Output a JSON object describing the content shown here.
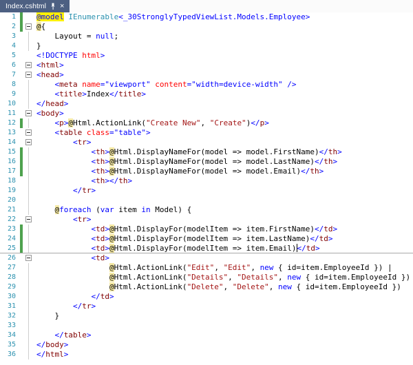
{
  "window": {
    "tab": {
      "title": "Index.cshtml",
      "pin_icon": "pin-icon",
      "close_glyph": "×"
    }
  },
  "palette": {
    "tabBg": "#4D6082",
    "tabFg": "#FFFFFF",
    "editorBg": "#FFFFFF",
    "lineNumber": "#2B91AF",
    "changeBar": "#4EA24E",
    "razorBg": "#F5E9A4",
    "highlightBg": "#FDF005",
    "caretLineBorder": "#A8A8A8",
    "colors": {
      "kw": "#0000FF",
      "type": "#2B91AF",
      "tag": "#800000",
      "attr": "#FF0000",
      "str": "#A31515",
      "txt": "#000000"
    }
  },
  "editor": {
    "lines": [
      {
        "n": 1,
        "fold": "",
        "chg": true,
        "seg": [
          {
            "t": "@model",
            "c": "kw",
            "b": "hl"
          },
          {
            "t": " "
          },
          {
            "t": "IEnumerable",
            "c": "type"
          },
          {
            "t": "<_30StronglyTypedViewList.Models.Employee>",
            "c": "kw"
          }
        ]
      },
      {
        "n": 2,
        "fold": "box",
        "chg": true,
        "seg": [
          {
            "t": "@",
            "b": "razor"
          },
          {
            "t": "{"
          }
        ]
      },
      {
        "n": 3,
        "fold": "line",
        "seg": [
          {
            "t": "    Layout = "
          },
          {
            "t": "null",
            "c": "kw"
          },
          {
            "t": ";"
          }
        ]
      },
      {
        "n": 4,
        "fold": "line",
        "seg": [
          {
            "t": "}"
          }
        ]
      },
      {
        "n": 5,
        "fold": "",
        "seg": [
          {
            "t": "<!DOCTYPE ",
            "c": "kw"
          },
          {
            "t": "html",
            "c": "attr"
          },
          {
            "t": ">",
            "c": "kw"
          }
        ]
      },
      {
        "n": 6,
        "fold": "box",
        "seg": [
          {
            "t": "<",
            "c": "kw"
          },
          {
            "t": "html",
            "c": "tag"
          },
          {
            "t": ">",
            "c": "kw"
          }
        ]
      },
      {
        "n": 7,
        "fold": "box",
        "seg": [
          {
            "t": "<",
            "c": "kw"
          },
          {
            "t": "head",
            "c": "tag"
          },
          {
            "t": ">",
            "c": "kw"
          }
        ]
      },
      {
        "n": 8,
        "fold": "line",
        "seg": [
          {
            "t": "    "
          },
          {
            "t": "<",
            "c": "kw"
          },
          {
            "t": "meta",
            "c": "tag"
          },
          {
            "t": " "
          },
          {
            "t": "name",
            "c": "attr"
          },
          {
            "t": "=",
            "c": "kw"
          },
          {
            "t": "\"viewport\"",
            "c": "kw"
          },
          {
            "t": " "
          },
          {
            "t": "content",
            "c": "attr"
          },
          {
            "t": "=",
            "c": "kw"
          },
          {
            "t": "\"width=device-width\"",
            "c": "kw"
          },
          {
            "t": " "
          },
          {
            "t": "/>",
            "c": "kw"
          }
        ]
      },
      {
        "n": 9,
        "fold": "line",
        "seg": [
          {
            "t": "    "
          },
          {
            "t": "<",
            "c": "kw"
          },
          {
            "t": "title",
            "c": "tag"
          },
          {
            "t": ">",
            "c": "kw"
          },
          {
            "t": "Index"
          },
          {
            "t": "</",
            "c": "kw"
          },
          {
            "t": "title",
            "c": "tag"
          },
          {
            "t": ">",
            "c": "kw"
          }
        ]
      },
      {
        "n": 10,
        "fold": "line",
        "seg": [
          {
            "t": "</",
            "c": "kw"
          },
          {
            "t": "head",
            "c": "tag"
          },
          {
            "t": ">",
            "c": "kw"
          }
        ]
      },
      {
        "n": 11,
        "fold": "box",
        "seg": [
          {
            "t": "<",
            "c": "kw"
          },
          {
            "t": "body",
            "c": "tag"
          },
          {
            "t": ">",
            "c": "kw"
          }
        ]
      },
      {
        "n": 12,
        "fold": "line",
        "chg": true,
        "seg": [
          {
            "t": "    "
          },
          {
            "t": "<",
            "c": "kw"
          },
          {
            "t": "p",
            "c": "tag"
          },
          {
            "t": ">",
            "c": "kw"
          },
          {
            "t": "@",
            "b": "razor"
          },
          {
            "t": "Html.ActionLink("
          },
          {
            "t": "\"Create New\"",
            "c": "str"
          },
          {
            "t": ", "
          },
          {
            "t": "\"Create\"",
            "c": "str"
          },
          {
            "t": ")"
          },
          {
            "t": "</",
            "c": "kw"
          },
          {
            "t": "p",
            "c": "tag"
          },
          {
            "t": ">",
            "c": "kw"
          }
        ]
      },
      {
        "n": 13,
        "fold": "box",
        "seg": [
          {
            "t": "    "
          },
          {
            "t": "<",
            "c": "kw"
          },
          {
            "t": "table",
            "c": "tag"
          },
          {
            "t": " "
          },
          {
            "t": "class",
            "c": "attr"
          },
          {
            "t": "=",
            "c": "kw"
          },
          {
            "t": "\"table\"",
            "c": "kw"
          },
          {
            "t": ">",
            "c": "kw"
          }
        ]
      },
      {
        "n": 14,
        "fold": "box",
        "seg": [
          {
            "t": "        "
          },
          {
            "t": "<",
            "c": "kw"
          },
          {
            "t": "tr",
            "c": "tag"
          },
          {
            "t": ">",
            "c": "kw"
          }
        ]
      },
      {
        "n": 15,
        "fold": "line",
        "chg": true,
        "seg": [
          {
            "t": "            "
          },
          {
            "t": "<",
            "c": "kw"
          },
          {
            "t": "th",
            "c": "tag"
          },
          {
            "t": ">",
            "c": "kw"
          },
          {
            "t": "@",
            "b": "razor"
          },
          {
            "t": "Html.DisplayNameFor(model => model.FirstName)"
          },
          {
            "t": "</",
            "c": "kw"
          },
          {
            "t": "th",
            "c": "tag"
          },
          {
            "t": ">",
            "c": "kw"
          }
        ]
      },
      {
        "n": 16,
        "fold": "line",
        "chg": true,
        "seg": [
          {
            "t": "            "
          },
          {
            "t": "<",
            "c": "kw"
          },
          {
            "t": "th",
            "c": "tag"
          },
          {
            "t": ">",
            "c": "kw"
          },
          {
            "t": "@",
            "b": "razor"
          },
          {
            "t": "Html.DisplayNameFor(model => model.LastName)"
          },
          {
            "t": "</",
            "c": "kw"
          },
          {
            "t": "th",
            "c": "tag"
          },
          {
            "t": ">",
            "c": "kw"
          }
        ]
      },
      {
        "n": 17,
        "fold": "line",
        "chg": true,
        "seg": [
          {
            "t": "            "
          },
          {
            "t": "<",
            "c": "kw"
          },
          {
            "t": "th",
            "c": "tag"
          },
          {
            "t": ">",
            "c": "kw"
          },
          {
            "t": "@",
            "b": "razor"
          },
          {
            "t": "Html.DisplayNameFor(model => model.Email)"
          },
          {
            "t": "</",
            "c": "kw"
          },
          {
            "t": "th",
            "c": "tag"
          },
          {
            "t": ">",
            "c": "kw"
          }
        ]
      },
      {
        "n": 18,
        "fold": "line",
        "seg": [
          {
            "t": "            "
          },
          {
            "t": "<",
            "c": "kw"
          },
          {
            "t": "th",
            "c": "tag"
          },
          {
            "t": ">",
            "c": "kw"
          },
          {
            "t": "</",
            "c": "kw"
          },
          {
            "t": "th",
            "c": "tag"
          },
          {
            "t": ">",
            "c": "kw"
          }
        ]
      },
      {
        "n": 19,
        "fold": "line",
        "seg": [
          {
            "t": "        "
          },
          {
            "t": "</",
            "c": "kw"
          },
          {
            "t": "tr",
            "c": "tag"
          },
          {
            "t": ">",
            "c": "kw"
          }
        ]
      },
      {
        "n": 20,
        "fold": "line",
        "seg": []
      },
      {
        "n": 21,
        "fold": "line",
        "seg": [
          {
            "t": "    "
          },
          {
            "t": "@",
            "b": "razor"
          },
          {
            "t": "foreach",
            "c": "kw"
          },
          {
            "t": " ("
          },
          {
            "t": "var",
            "c": "kw"
          },
          {
            "t": " item "
          },
          {
            "t": "in",
            "c": "kw"
          },
          {
            "t": " Model) {"
          }
        ]
      },
      {
        "n": 22,
        "fold": "box",
        "seg": [
          {
            "t": "        "
          },
          {
            "t": "<",
            "c": "kw"
          },
          {
            "t": "tr",
            "c": "tag"
          },
          {
            "t": ">",
            "c": "kw"
          }
        ]
      },
      {
        "n": 23,
        "fold": "line",
        "chg": true,
        "seg": [
          {
            "t": "            "
          },
          {
            "t": "<",
            "c": "kw"
          },
          {
            "t": "td",
            "c": "tag"
          },
          {
            "t": ">",
            "c": "kw"
          },
          {
            "t": "@",
            "b": "razor"
          },
          {
            "t": "Html.DisplayFor(modelItem => item.FirstName)"
          },
          {
            "t": "</",
            "c": "kw"
          },
          {
            "t": "td",
            "c": "tag"
          },
          {
            "t": ">",
            "c": "kw"
          }
        ]
      },
      {
        "n": 24,
        "fold": "line",
        "chg": true,
        "seg": [
          {
            "t": "            "
          },
          {
            "t": "<",
            "c": "kw"
          },
          {
            "t": "td",
            "c": "tag"
          },
          {
            "t": ">",
            "c": "kw"
          },
          {
            "t": "@",
            "b": "razor"
          },
          {
            "t": "Html.DisplayFor(modelItem => item.LastName)"
          },
          {
            "t": "</",
            "c": "kw"
          },
          {
            "t": "td",
            "c": "tag"
          },
          {
            "t": ">",
            "c": "kw"
          }
        ]
      },
      {
        "n": 25,
        "fold": "line",
        "chg": true,
        "caret_line": true,
        "seg": [
          {
            "t": "            "
          },
          {
            "t": "<",
            "c": "kw"
          },
          {
            "t": "td",
            "c": "tag"
          },
          {
            "t": ">",
            "c": "kw"
          },
          {
            "t": "@",
            "b": "razor"
          },
          {
            "t": "Html.DisplayFor(modelItem => item.Email)"
          },
          {
            "caret": true
          },
          {
            "t": "</",
            "c": "kw"
          },
          {
            "t": "td",
            "c": "tag"
          },
          {
            "t": ">",
            "c": "kw"
          }
        ]
      },
      {
        "n": 26,
        "fold": "box",
        "seg": [
          {
            "t": "            "
          },
          {
            "t": "<",
            "c": "kw"
          },
          {
            "t": "td",
            "c": "tag"
          },
          {
            "t": ">",
            "c": "kw"
          }
        ]
      },
      {
        "n": 27,
        "fold": "line",
        "seg": [
          {
            "t": "                "
          },
          {
            "t": "@",
            "b": "razor"
          },
          {
            "t": "Html.ActionLink("
          },
          {
            "t": "\"Edit\"",
            "c": "str"
          },
          {
            "t": ", "
          },
          {
            "t": "\"Edit\"",
            "c": "str"
          },
          {
            "t": ", "
          },
          {
            "t": "new",
            "c": "kw"
          },
          {
            "t": " { id=item.EmployeeId }) |"
          }
        ]
      },
      {
        "n": 28,
        "fold": "line",
        "seg": [
          {
            "t": "                "
          },
          {
            "t": "@",
            "b": "razor"
          },
          {
            "t": "Html.ActionLink("
          },
          {
            "t": "\"Details\"",
            "c": "str"
          },
          {
            "t": ", "
          },
          {
            "t": "\"Details\"",
            "c": "str"
          },
          {
            "t": ", "
          },
          {
            "t": "new",
            "c": "kw"
          },
          {
            "t": " { id=item.EmployeeId }) |"
          }
        ]
      },
      {
        "n": 29,
        "fold": "line",
        "seg": [
          {
            "t": "                "
          },
          {
            "t": "@",
            "b": "razor"
          },
          {
            "t": "Html.ActionLink("
          },
          {
            "t": "\"Delete\"",
            "c": "str"
          },
          {
            "t": ", "
          },
          {
            "t": "\"Delete\"",
            "c": "str"
          },
          {
            "t": ", "
          },
          {
            "t": "new",
            "c": "kw"
          },
          {
            "t": " { id=item.EmployeeId })"
          }
        ]
      },
      {
        "n": 30,
        "fold": "line",
        "seg": [
          {
            "t": "            "
          },
          {
            "t": "</",
            "c": "kw"
          },
          {
            "t": "td",
            "c": "tag"
          },
          {
            "t": ">",
            "c": "kw"
          }
        ]
      },
      {
        "n": 31,
        "fold": "line",
        "seg": [
          {
            "t": "        "
          },
          {
            "t": "</",
            "c": "kw"
          },
          {
            "t": "tr",
            "c": "tag"
          },
          {
            "t": ">",
            "c": "kw"
          }
        ]
      },
      {
        "n": 32,
        "fold": "line",
        "seg": [
          {
            "t": "    }"
          }
        ]
      },
      {
        "n": 33,
        "fold": "line",
        "seg": []
      },
      {
        "n": 34,
        "fold": "line",
        "seg": [
          {
            "t": "    "
          },
          {
            "t": "</",
            "c": "kw"
          },
          {
            "t": "table",
            "c": "tag"
          },
          {
            "t": ">",
            "c": "kw"
          }
        ]
      },
      {
        "n": 35,
        "fold": "line",
        "seg": [
          {
            "t": "</",
            "c": "kw"
          },
          {
            "t": "body",
            "c": "tag"
          },
          {
            "t": ">",
            "c": "kw"
          }
        ]
      },
      {
        "n": 36,
        "fold": "line",
        "seg": [
          {
            "t": "</",
            "c": "kw"
          },
          {
            "t": "html",
            "c": "tag"
          },
          {
            "t": ">",
            "c": "kw"
          }
        ]
      }
    ]
  }
}
